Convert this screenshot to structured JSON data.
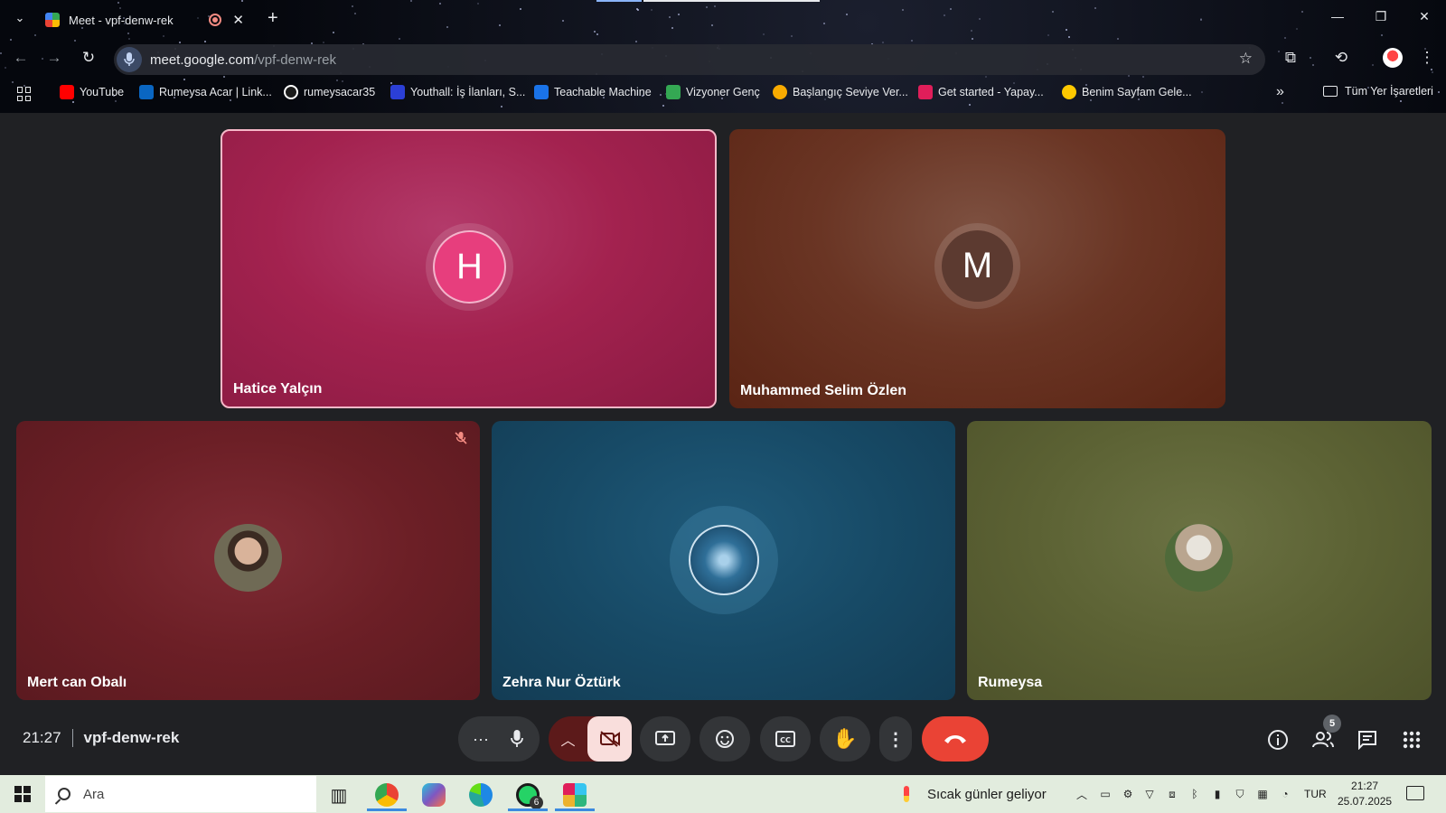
{
  "browser": {
    "tab": {
      "title": "Meet - vpf-denw-rek"
    },
    "address": {
      "host": "meet.google.com",
      "path": "/vpf-denw-rek"
    },
    "bookmarks": [
      {
        "label": "YouTube",
        "icon": "youtube-icon",
        "color": "#ff0000"
      },
      {
        "label": "Rumeysa Acar | Link...",
        "icon": "linkedin-icon",
        "color": "#0a66c2"
      },
      {
        "label": "rumeysacar35",
        "icon": "github-icon",
        "color": "#ffffff"
      },
      {
        "label": "Youthall: İş İlanları, S...",
        "icon": "youthall-icon",
        "color": "#2b3fd6"
      },
      {
        "label": "Teachable Machine",
        "icon": "teachable-machine-icon",
        "color": "#1a73e8"
      },
      {
        "label": "Vizyoner Genç",
        "icon": "vizyoner-genc-icon",
        "color": "#34a853"
      },
      {
        "label": "Başlangıç Seviye Ver...",
        "icon": "circle-icon",
        "color": "#f9ab00"
      },
      {
        "label": "Get started - Yapay...",
        "icon": "slack-icon",
        "color": "#e01e5a"
      },
      {
        "label": "Benim Sayfam Gele...",
        "icon": "turkcell-icon",
        "color": "#ffc900"
      }
    ],
    "all_bookmarks_label": "Tüm Yer İşaretleri"
  },
  "meet": {
    "participants": [
      {
        "name": "Hatice Yalçın",
        "initial": "H",
        "speaking": true
      },
      {
        "name": "Muhammed Selim Özlen",
        "initial": "M",
        "speaking": false
      },
      {
        "name": "Mert can Obalı",
        "muted": true
      },
      {
        "name": "Zehra Nur Öztürk"
      },
      {
        "name": "Rumeysa"
      }
    ],
    "time": "21:27",
    "code": "vpf-denw-rek",
    "people_count": "5",
    "colors": {
      "leave": "#ea4335",
      "camera_off": "#f9dedc",
      "speaking_border": "#f6b8c8"
    }
  },
  "taskbar": {
    "search_placeholder": "Ara",
    "whatsapp_badge": "6",
    "weather": "Sıcak günler geliyor",
    "language": "TUR",
    "time": "21:27",
    "date": "25.07.2025"
  }
}
